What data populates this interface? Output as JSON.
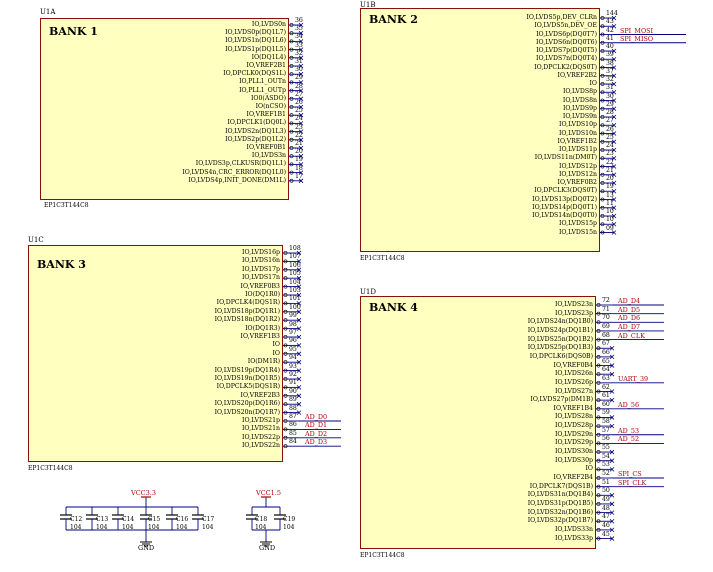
{
  "schematic": {
    "u1a": {
      "ref": "U1A",
      "title": "BANK 1",
      "part": "EP1C3T144C8",
      "pins": [
        {
          "name": "IO,LVDS0n",
          "num": "36"
        },
        {
          "name": "IO,LVDS0p(DQ1L7)",
          "num": "35"
        },
        {
          "name": "IO,LVDS1n(DQ1L6)",
          "num": "34"
        },
        {
          "name": "IO,LVDS1p(DQ1L5)",
          "num": "33"
        },
        {
          "name": "IO(DQ1L4)",
          "num": "32"
        },
        {
          "name": "IO,VREF2B1",
          "num": "31"
        },
        {
          "name": "IO,DPCLK0(DQS1L)",
          "num": "30"
        },
        {
          "name": "IO,PLL1_OUTn",
          "num": "29"
        },
        {
          "name": "IO,PLL1_OUTp",
          "num": "28"
        },
        {
          "name": "IO0(ASDO)",
          "num": "27"
        },
        {
          "name": "IO(nCSO)",
          "num": "26"
        },
        {
          "name": "IO,VREF1B1",
          "num": "25"
        },
        {
          "name": "IO,DPCLK1(DQ0L)",
          "num": "24"
        },
        {
          "name": "IO,LVDS2n(DQ1L3)",
          "num": "23"
        },
        {
          "name": "IO,LVDS2p(DQ1L2)",
          "num": "22"
        },
        {
          "name": "IO,VREF0B1",
          "num": "21"
        },
        {
          "name": "IO,LVDS3n",
          "num": "20"
        },
        {
          "name": "IO,LVDS3p,CLKUSR(DQ1L1)",
          "num": "19"
        },
        {
          "name": "IO,LVDS4n,CRC_ERROR(DQ1L0)",
          "num": "18"
        },
        {
          "name": "IO,LVDS4p,INIT_DONE(DM1L)",
          "num": "17"
        }
      ]
    },
    "u1b": {
      "ref": "U1B",
      "title": "BANK 2",
      "part": "EP1C3T144C8",
      "pins": [
        {
          "name": "IO,LVDS5p,DEV_CLRn",
          "num": "144",
          "net": ""
        },
        {
          "name": "IO,LVDS5n,DEV_OE",
          "num": "43",
          "net": ""
        },
        {
          "name": "IO,LVDS6p(DQ0T7)",
          "num": "42",
          "net": "SPI_MOSI"
        },
        {
          "name": "IO,LVDS6n(DQ0T6)",
          "num": "41",
          "net": "SPI_MISO"
        },
        {
          "name": "IO,LVDS7p(DQ0T5)",
          "num": "40",
          "net": ""
        },
        {
          "name": "IO,LVDS7n(DQ0T4)",
          "num": "39",
          "net": ""
        },
        {
          "name": "IO,DPCLK2(DQS0T)",
          "num": "38",
          "net": ""
        },
        {
          "name": "IO,VREF2B2",
          "num": "37",
          "net": ""
        },
        {
          "name": "IO",
          "num": "32",
          "net": ""
        },
        {
          "name": "IO,LVDS8p",
          "num": "31",
          "net": ""
        },
        {
          "name": "IO,LVDS8n",
          "num": "30",
          "net": ""
        },
        {
          "name": "IO,LVDS9p",
          "num": "29",
          "net": ""
        },
        {
          "name": "IO,LVDS9n",
          "num": "28",
          "net": ""
        },
        {
          "name": "IO,LVDS10p",
          "num": "27",
          "net": ""
        },
        {
          "name": "IO,LVDS10n",
          "num": "26",
          "net": ""
        },
        {
          "name": "IO,VREF1B2",
          "num": "25",
          "net": ""
        },
        {
          "name": "IO,LVDS11p",
          "num": "24",
          "net": ""
        },
        {
          "name": "IO,LVDS11n(DM0T)",
          "num": "23",
          "net": ""
        },
        {
          "name": "IO,LVDS12p",
          "num": "22",
          "net": ""
        },
        {
          "name": "IO,LVDS12n",
          "num": "21",
          "net": ""
        },
        {
          "name": "IO,VREF0B2",
          "num": "20",
          "net": ""
        },
        {
          "name": "IO,DPCLK3(DQS0T)",
          "num": "19",
          "net": ""
        },
        {
          "name": "IO,LVDS13p(DQ0T2)",
          "num": "13",
          "net": ""
        },
        {
          "name": "IO,LVDS14p(DQ0T1)",
          "num": "11",
          "net": ""
        },
        {
          "name": "IO,LVDS14n(DQ0T0)",
          "num": "10",
          "net": ""
        },
        {
          "name": "IO,LVDS15p",
          "num": "10",
          "net": ""
        },
        {
          "name": "IO,LVDS15n",
          "num": "09",
          "net": ""
        }
      ]
    },
    "u1c": {
      "ref": "U1C",
      "title": "BANK 3",
      "part": "EP1C3T144C8",
      "pins": [
        {
          "name": "IO,LVDS16p",
          "num": "108",
          "net": ""
        },
        {
          "name": "IO,LVDS16n",
          "num": "107",
          "net": ""
        },
        {
          "name": "IO,LVDS17p",
          "num": "106",
          "net": ""
        },
        {
          "name": "IO,LVDS17n",
          "num": "105",
          "net": ""
        },
        {
          "name": "IO,VREF0B3",
          "num": "104",
          "net": ""
        },
        {
          "name": "IO(DQ1R0)",
          "num": "103",
          "net": ""
        },
        {
          "name": "IO,DPCLK4(DQS1R)",
          "num": "101",
          "net": ""
        },
        {
          "name": "IO,LVDS18p(DQ1R1)",
          "num": "100",
          "net": ""
        },
        {
          "name": "IO,LVDS18n(DQ1R2)",
          "num": "99",
          "net": ""
        },
        {
          "name": "IO(DQ1R3)",
          "num": "98",
          "net": ""
        },
        {
          "name": "IO,VREF1B3",
          "num": "97",
          "net": ""
        },
        {
          "name": "IO",
          "num": "96",
          "net": ""
        },
        {
          "name": "IO",
          "num": "95",
          "net": ""
        },
        {
          "name": "IO(DM1R)",
          "num": "94",
          "net": ""
        },
        {
          "name": "IO,LVDS19p(DQ1R4)",
          "num": "93",
          "net": ""
        },
        {
          "name": "IO,LVDS19n(DQ1R5)",
          "num": "92",
          "net": ""
        },
        {
          "name": "IO,DPCLK5(DQS1R)",
          "num": "91",
          "net": ""
        },
        {
          "name": "IO,VREF2B3",
          "num": "90",
          "net": ""
        },
        {
          "name": "IO,LVDS20p(DQ1R6)",
          "num": "89",
          "net": ""
        },
        {
          "name": "IO,LVDS20n(DQ1R7)",
          "num": "88",
          "net": ""
        },
        {
          "name": "IO,LVDS21p",
          "num": "87",
          "net": "AD_D0"
        },
        {
          "name": "IO,LVDS21n",
          "num": "86",
          "net": "AD_D1"
        },
        {
          "name": "IO,LVDS22p",
          "num": "85",
          "net": "AD_D2"
        },
        {
          "name": "IO,LVDS22n",
          "num": "84",
          "net": "AD_D3"
        }
      ]
    },
    "u1d": {
      "ref": "U1D",
      "title": "BANK 4",
      "part": "EP1C3T144C8",
      "pins": [
        {
          "name": "IO,LVDS23n",
          "num": "72",
          "net": "AD_D4"
        },
        {
          "name": "IO,LVDS23p",
          "num": "71",
          "net": "AD_D5"
        },
        {
          "name": "IO,LVDS24n(DQ1B0)",
          "num": "70",
          "net": "AD_D6"
        },
        {
          "name": "IO,LVDS24p(DQ1B1)",
          "num": "69",
          "net": "AD_D7"
        },
        {
          "name": "IO,LVDS25n(DQ1B2)",
          "num": "68",
          "net": "AD_CLK"
        },
        {
          "name": "IO,LVDS25p(DQ1B3)",
          "num": "67",
          "net": ""
        },
        {
          "name": "IO,DPCLK6(DQS0B)",
          "num": "66",
          "net": ""
        },
        {
          "name": "IO,VREF0B4",
          "num": "65",
          "net": ""
        },
        {
          "name": "IO,LVDS26n",
          "num": "64",
          "net": ""
        },
        {
          "name": "IO,LVDS26p",
          "num": "63",
          "net": "UART_39"
        },
        {
          "name": "IO,LVDS27n",
          "num": "62",
          "net": ""
        },
        {
          "name": "IO,LVDS27p(DM1B)",
          "num": "61",
          "net": ""
        },
        {
          "name": "IO,VREF1B4",
          "num": "60",
          "net": "AD_56"
        },
        {
          "name": "IO,LVDS28n",
          "num": "59",
          "net": ""
        },
        {
          "name": "IO,LVDS28p",
          "num": "58",
          "net": ""
        },
        {
          "name": "IO,LVDS29n",
          "num": "57",
          "net": "AD_53"
        },
        {
          "name": "IO,LVDS29p",
          "num": "56",
          "net": "AD_52"
        },
        {
          "name": "IO,LVDS30n",
          "num": "55",
          "net": ""
        },
        {
          "name": "IO,LVDS30p",
          "num": "54",
          "net": ""
        },
        {
          "name": "IO",
          "num": "53",
          "net": ""
        },
        {
          "name": "IO,VREF2B4",
          "num": "52",
          "net": "SPI_CS"
        },
        {
          "name": "IO,DPCLK7(DQS1B)",
          "num": "51",
          "net": "SPI_CLK"
        },
        {
          "name": "IO,LVDS31n(DQ1B4)",
          "num": "50",
          "net": ""
        },
        {
          "name": "IO,LVDS31p(DQ1B5)",
          "num": "49",
          "net": ""
        },
        {
          "name": "IO,LVDS32n(DQ1B6)",
          "num": "48",
          "net": ""
        },
        {
          "name": "IO,LVDS32p(DQ1B7)",
          "num": "47",
          "net": ""
        },
        {
          "name": "IO,LVDS33n",
          "num": "46",
          "net": ""
        },
        {
          "name": "IO,LVDS33p",
          "num": "45",
          "net": ""
        }
      ]
    },
    "power_left": {
      "rail": "VCC3.3",
      "ground": "GND",
      "caps": [
        {
          "ref": "C12",
          "value": "104"
        },
        {
          "ref": "C13",
          "value": "104"
        },
        {
          "ref": "C14",
          "value": "104"
        },
        {
          "ref": "C15",
          "value": "104"
        },
        {
          "ref": "C16",
          "value": "104"
        },
        {
          "ref": "C17",
          "value": "104"
        }
      ]
    },
    "power_right": {
      "rail": "VCC1.5",
      "ground": "GND",
      "caps": [
        {
          "ref": "C18",
          "value": "104"
        },
        {
          "ref": "C19",
          "value": "104"
        }
      ]
    },
    "colors": {
      "wire": "#000080",
      "net": "#b00000",
      "body": "#ffffc0",
      "border": "#8a1010",
      "power": "#b00000"
    }
  }
}
